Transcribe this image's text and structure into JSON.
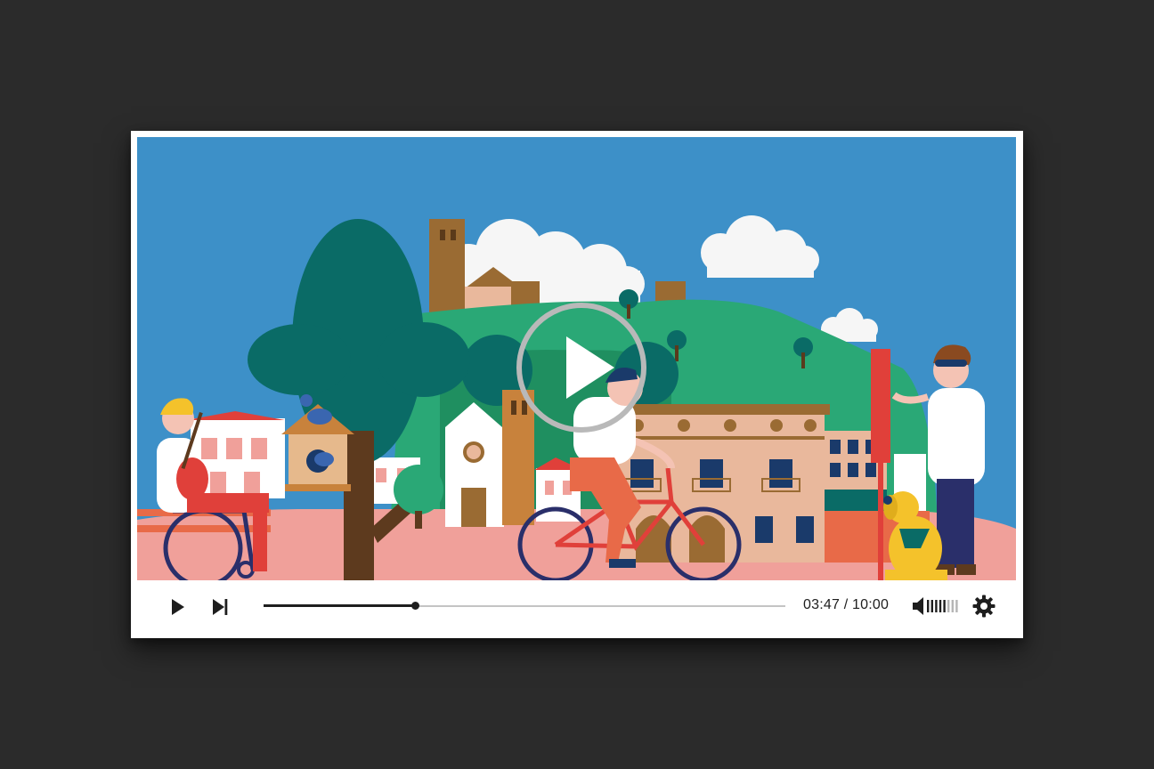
{
  "player": {
    "time": {
      "current": "03:47",
      "separator": "/",
      "total": "10:00"
    },
    "progress_fraction": 0.29,
    "volume_fraction": 0.6,
    "controls": {
      "play_icon": "play-icon",
      "next_icon": "skip-next-icon",
      "volume_icon": "volume-icon",
      "settings_icon": "gear-icon",
      "overlay_icon": "play-circle-icon"
    },
    "colors": {
      "sky": "#3d90c8",
      "ground": "#f0a09a",
      "hill": "#2aa876",
      "tree": "#0a6b66",
      "accent_red": "#e0403a"
    }
  }
}
